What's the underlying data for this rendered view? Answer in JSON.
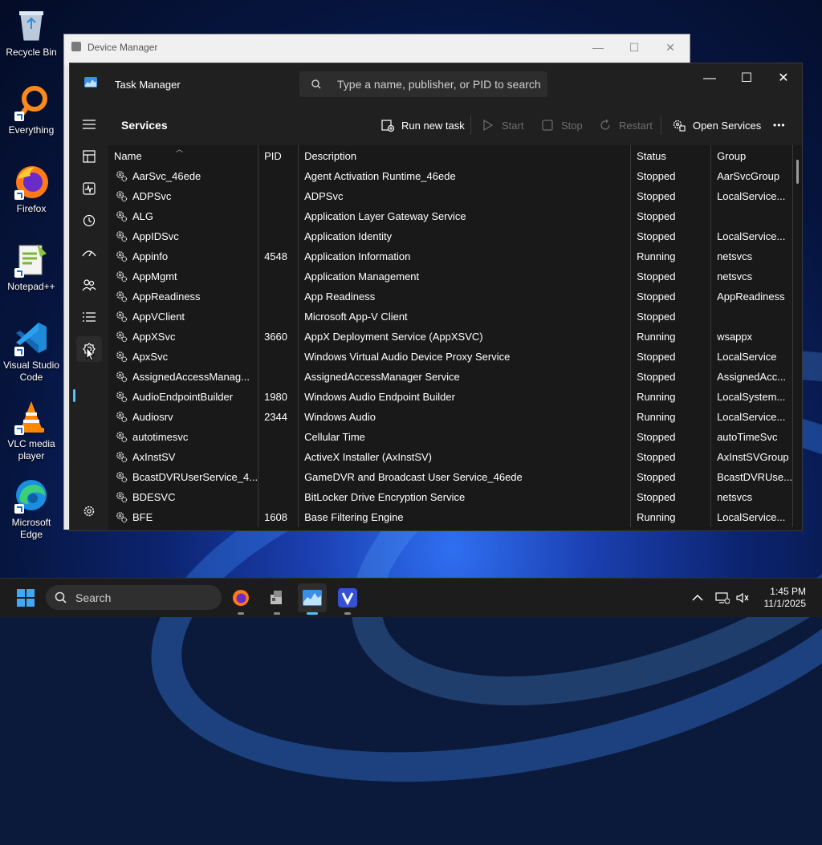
{
  "desktop": {
    "icons": [
      {
        "label": "Recycle Bin",
        "icon": "recycle-bin-icon"
      },
      {
        "label": "Everything",
        "icon": "everything-icon"
      },
      {
        "label": "Firefox",
        "icon": "firefox-icon"
      },
      {
        "label": "Notepad++",
        "icon": "notepad-plus-plus-icon"
      },
      {
        "label": "Visual Studio Code",
        "icon": "vscode-icon"
      },
      {
        "label": "VLC media player",
        "icon": "vlc-icon"
      },
      {
        "label": "Microsoft Edge",
        "icon": "edge-icon"
      }
    ]
  },
  "device_manager": {
    "title": "Device Manager"
  },
  "task_manager": {
    "title": "Task Manager",
    "search_placeholder": "Type a name, publisher, or PID to search",
    "page_title": "Services",
    "toolbar": {
      "run_new_task": "Run new task",
      "start": "Start",
      "stop": "Stop",
      "restart": "Restart",
      "open_services": "Open Services",
      "more": "•••"
    },
    "columns": {
      "name": "Name",
      "pid": "PID",
      "description": "Description",
      "status": "Status",
      "group": "Group"
    },
    "rows": [
      {
        "name": "AarSvc_46ede",
        "pid": "",
        "description": "Agent Activation Runtime_46ede",
        "status": "Stopped",
        "group": "AarSvcGroup"
      },
      {
        "name": "ADPSvc",
        "pid": "",
        "description": "ADPSvc",
        "status": "Stopped",
        "group": "LocalService..."
      },
      {
        "name": "ALG",
        "pid": "",
        "description": "Application Layer Gateway Service",
        "status": "Stopped",
        "group": ""
      },
      {
        "name": "AppIDSvc",
        "pid": "",
        "description": "Application Identity",
        "status": "Stopped",
        "group": "LocalService..."
      },
      {
        "name": "Appinfo",
        "pid": "4548",
        "description": "Application Information",
        "status": "Running",
        "group": "netsvcs"
      },
      {
        "name": "AppMgmt",
        "pid": "",
        "description": "Application Management",
        "status": "Stopped",
        "group": "netsvcs"
      },
      {
        "name": "AppReadiness",
        "pid": "",
        "description": "App Readiness",
        "status": "Stopped",
        "group": "AppReadiness"
      },
      {
        "name": "AppVClient",
        "pid": "",
        "description": "Microsoft App-V Client",
        "status": "Stopped",
        "group": ""
      },
      {
        "name": "AppXSvc",
        "pid": "3660",
        "description": "AppX Deployment Service (AppXSVC)",
        "status": "Running",
        "group": "wsappx"
      },
      {
        "name": "ApxSvc",
        "pid": "",
        "description": "Windows Virtual Audio Device Proxy Service",
        "status": "Stopped",
        "group": "LocalService"
      },
      {
        "name": "AssignedAccessManag...",
        "pid": "",
        "description": "AssignedAccessManager Service",
        "status": "Stopped",
        "group": "AssignedAcc..."
      },
      {
        "name": "AudioEndpointBuilder",
        "pid": "1980",
        "description": "Windows Audio Endpoint Builder",
        "status": "Running",
        "group": "LocalSystem..."
      },
      {
        "name": "Audiosrv",
        "pid": "2344",
        "description": "Windows Audio",
        "status": "Running",
        "group": "LocalService..."
      },
      {
        "name": "autotimesvc",
        "pid": "",
        "description": "Cellular Time",
        "status": "Stopped",
        "group": "autoTimeSvc"
      },
      {
        "name": "AxInstSV",
        "pid": "",
        "description": "ActiveX Installer (AxInstSV)",
        "status": "Stopped",
        "group": "AxInstSVGroup"
      },
      {
        "name": "BcastDVRUserService_4...",
        "pid": "",
        "description": "GameDVR and Broadcast User Service_46ede",
        "status": "Stopped",
        "group": "BcastDVRUse..."
      },
      {
        "name": "BDESVC",
        "pid": "",
        "description": "BitLocker Drive Encryption Service",
        "status": "Stopped",
        "group": "netsvcs"
      },
      {
        "name": "BFE",
        "pid": "1608",
        "description": "Base Filtering Engine",
        "status": "Running",
        "group": "LocalService..."
      }
    ]
  },
  "taskbar": {
    "search_label": "Search",
    "time": "1:45 PM",
    "date": "11/1/2025"
  },
  "colors": {
    "accent": "#4cc2ff",
    "window_bg": "#202020",
    "list_bg": "#191919"
  }
}
